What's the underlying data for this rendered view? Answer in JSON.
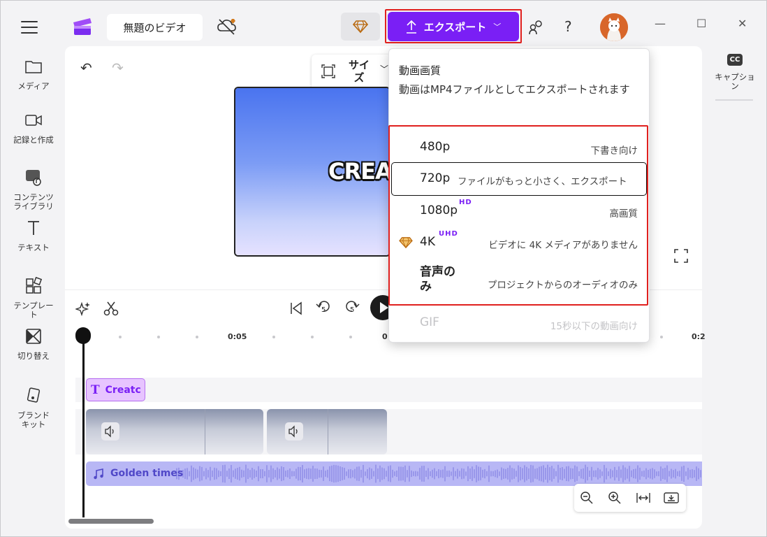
{
  "topbar": {
    "title": "無題のビデオ",
    "export_label": "エクスポート",
    "help_label": "?",
    "window_controls": [
      "—",
      "☐",
      "✕"
    ]
  },
  "sidebar": {
    "items": [
      {
        "label": "メディア",
        "icon": "folder-icon"
      },
      {
        "label": "記録と作成",
        "icon": "camera-icon"
      },
      {
        "label": "コンテンツ\nライブラリ",
        "icon": "content-library-icon"
      },
      {
        "label": "テキスト",
        "icon": "text-icon"
      },
      {
        "label": "テンプレー\nト",
        "icon": "template-icon"
      },
      {
        "label": "切り替え",
        "icon": "transition-icon"
      },
      {
        "label": "ブランド\nキット",
        "icon": "brand-kit-icon"
      }
    ]
  },
  "canvas": {
    "size_label": "サイ\nズ",
    "preview_text": "CREAT"
  },
  "timeline": {
    "rewind_seconds": "5",
    "forward_seconds": "5",
    "ruler": [
      "0:05",
      "0",
      "0:2"
    ],
    "text_clip": "Creatc",
    "audio_clip": "Golden times"
  },
  "right_rail": {
    "cc": "CC",
    "caption_label": "キャプショ\nン"
  },
  "export_menu": {
    "title": "動画画質",
    "description": "動画はMP4ファイルとしてエクスポートされます",
    "options": [
      {
        "name": "480p",
        "badge": "",
        "desc": "下書き向け",
        "premium": false,
        "selected": false
      },
      {
        "name": "720p",
        "badge": "",
        "desc": "ファイルがもっと小さく、エクスポート",
        "premium": false,
        "selected": true
      },
      {
        "name": "1080p",
        "badge": "HD",
        "desc": "高画質",
        "premium": false,
        "selected": false
      },
      {
        "name": "4K",
        "badge": "UHD",
        "desc": "ビデオに 4K メディアがありません",
        "premium": true,
        "selected": false
      },
      {
        "name": "音声の\nみ",
        "badge": "",
        "desc": "プロジェクトからのオーディオのみ",
        "premium": false,
        "selected": false
      }
    ],
    "gif": {
      "name": "GIF",
      "desc": "15秒以下の動画向け"
    }
  },
  "colors": {
    "accent": "#7a1ff5",
    "highlight": "#e0201e",
    "premium": "#d17a1d"
  }
}
